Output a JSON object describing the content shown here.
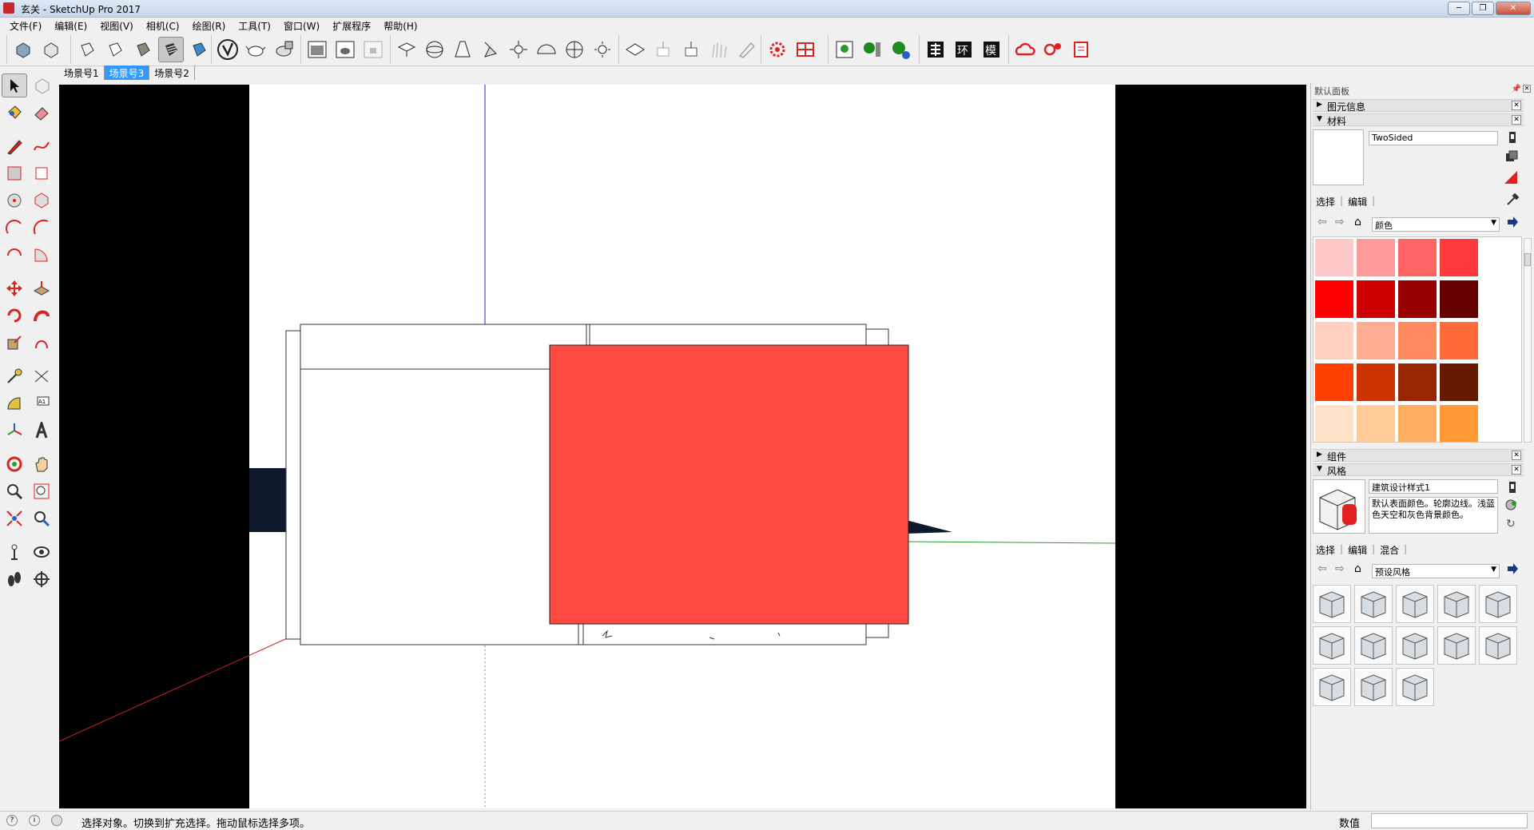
{
  "window": {
    "title": "玄关 - SketchUp Pro 2017",
    "min": "─",
    "max": "❐",
    "close": "✕"
  },
  "menu": [
    "文件(F)",
    "编辑(E)",
    "视图(V)",
    "相机(C)",
    "绘图(R)",
    "工具(T)",
    "窗口(W)",
    "扩展程序",
    "帮助(H)"
  ],
  "scenes": [
    "场景号1",
    "场景号3",
    "场景号2"
  ],
  "active_scene": "场景号3",
  "status": {
    "hint": "选择对象。切换到扩充选择。拖动鼠标选择多项。",
    "measure_label": "数值",
    "measure_value": ""
  },
  "panel": {
    "title": "默认面板",
    "entity_info": "图元信息",
    "materials": {
      "header": "材料",
      "name": "TwoSided",
      "tab_select": "选择",
      "tab_edit": "编辑",
      "library": "颜色",
      "swatches": [
        "#ffc8c8",
        "#ff9a9a",
        "#ff6464",
        "#ff3a3a",
        "#ff0000",
        "#cc0000",
        "#990000",
        "#660000",
        "#ffd0c0",
        "#ffad90",
        "#ff8a60",
        "#ff6a3a",
        "#ff4000",
        "#cc3300",
        "#992600",
        "#661a00",
        "#ffe2c8",
        "#ffcc99",
        "#ffad60",
        "#ff9933"
      ]
    },
    "components": "组件",
    "styles": {
      "header": "风格",
      "name": "建筑设计样式1",
      "description": "默认表面颜色。轮廓边线。浅蓝色天空和灰色背景颜色。",
      "tab_select": "选择",
      "tab_edit": "编辑",
      "tab_mix": "混合",
      "library": "预设风格"
    }
  },
  "colors": {
    "selected_face": "#ff4a42",
    "scene_active": "#3399ff"
  }
}
